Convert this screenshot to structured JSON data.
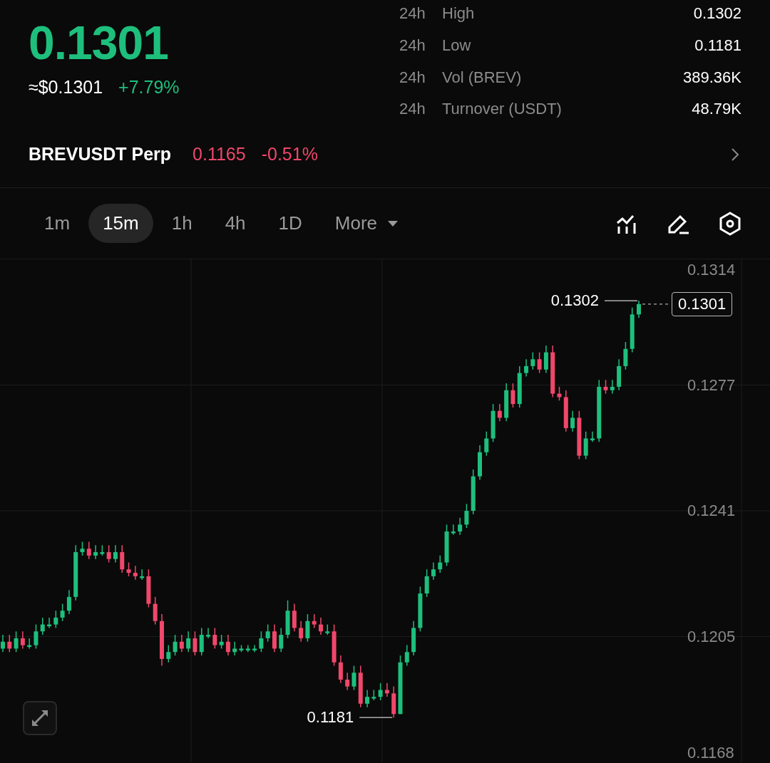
{
  "ticker": {
    "last_price": "0.1301",
    "usd_price": "≈$0.1301",
    "change": "+7.79%"
  },
  "stats": [
    {
      "period": "24h",
      "label": "High",
      "value": "0.1302"
    },
    {
      "period": "24h",
      "label": "Low",
      "value": "0.1181"
    },
    {
      "period": "24h",
      "label": "Vol (BREV)",
      "value": "389.36K"
    },
    {
      "period": "24h",
      "label": "Turnover (USDT)",
      "value": "48.79K"
    }
  ],
  "perp": {
    "name": "BREVUSDT Perp",
    "price": "0.1165",
    "change": "-0.51%"
  },
  "intervals": [
    {
      "label": "1m",
      "selected": false
    },
    {
      "label": "15m",
      "selected": true
    },
    {
      "label": "1h",
      "selected": false
    },
    {
      "label": "4h",
      "selected": false
    },
    {
      "label": "1D",
      "selected": false
    },
    {
      "label": "More",
      "selected": false,
      "kind": "dropdown"
    }
  ],
  "chart": {
    "chart_data": {
      "type": "candlestick",
      "grid": true,
      "ohlc": [
        [
          0.1201,
          0.1205,
          0.12,
          0.1203
        ],
        [
          0.1203,
          0.1205,
          0.12,
          0.1201
        ],
        [
          0.1201,
          0.1206,
          0.12,
          0.1204
        ],
        [
          0.1204,
          0.1206,
          0.1201,
          0.1202
        ],
        [
          0.1202,
          0.1204,
          0.1201,
          0.1202
        ],
        [
          0.1202,
          0.1208,
          0.1201,
          0.1206
        ],
        [
          0.1206,
          0.121,
          0.1205,
          0.1208
        ],
        [
          0.1208,
          0.121,
          0.1207,
          0.1208
        ],
        [
          0.1208,
          0.1212,
          0.1207,
          0.121
        ],
        [
          0.121,
          0.1214,
          0.1209,
          0.1212
        ],
        [
          0.1212,
          0.1218,
          0.1211,
          0.1216
        ],
        [
          0.1216,
          0.1231,
          0.1215,
          0.1229
        ],
        [
          0.1229,
          0.1232,
          0.1228,
          0.123
        ],
        [
          0.123,
          0.1232,
          0.1227,
          0.1228
        ],
        [
          0.1228,
          0.1231,
          0.1227,
          0.1229
        ],
        [
          0.1229,
          0.1231,
          0.1228,
          0.1229
        ],
        [
          0.1229,
          0.1231,
          0.1226,
          0.1227
        ],
        [
          0.1227,
          0.1231,
          0.1226,
          0.1229
        ],
        [
          0.1229,
          0.1231,
          0.1223,
          0.1224
        ],
        [
          0.1224,
          0.1226,
          0.1222,
          0.1223
        ],
        [
          0.1223,
          0.1225,
          0.1221,
          0.1222
        ],
        [
          0.1222,
          0.1224,
          0.1221,
          0.1222
        ],
        [
          0.1222,
          0.1224,
          0.1213,
          0.1214
        ],
        [
          0.1214,
          0.1216,
          0.1208,
          0.1209
        ],
        [
          0.1209,
          0.1211,
          0.1196,
          0.1198
        ],
        [
          0.1198,
          0.1202,
          0.1197,
          0.12
        ],
        [
          0.12,
          0.1205,
          0.1199,
          0.1203
        ],
        [
          0.1203,
          0.1205,
          0.12,
          0.1201
        ],
        [
          0.1201,
          0.1206,
          0.12,
          0.1204
        ],
        [
          0.1204,
          0.1206,
          0.1199,
          0.12
        ],
        [
          0.12,
          0.1207,
          0.1199,
          0.1205
        ],
        [
          0.1205,
          0.1207,
          0.1204,
          0.1205
        ],
        [
          0.1205,
          0.1207,
          0.1201,
          0.1202
        ],
        [
          0.1202,
          0.1205,
          0.1201,
          0.1203
        ],
        [
          0.1203,
          0.1205,
          0.1199,
          0.12
        ],
        [
          0.12,
          0.1203,
          0.1199,
          0.1201
        ],
        [
          0.1201,
          0.1202,
          0.12,
          0.1201
        ],
        [
          0.1201,
          0.1202,
          0.12,
          0.1201
        ],
        [
          0.1201,
          0.1202,
          0.12,
          0.1201
        ],
        [
          0.1201,
          0.1206,
          0.12,
          0.1204
        ],
        [
          0.1204,
          0.1208,
          0.1203,
          0.1206
        ],
        [
          0.1206,
          0.1208,
          0.12,
          0.1201
        ],
        [
          0.1201,
          0.1207,
          0.12,
          0.1205
        ],
        [
          0.1205,
          0.1215,
          0.1204,
          0.1212
        ],
        [
          0.1212,
          0.1214,
          0.1206,
          0.1207
        ],
        [
          0.1207,
          0.1209,
          0.1203,
          0.1204
        ],
        [
          0.1204,
          0.1211,
          0.1203,
          0.1209
        ],
        [
          0.1209,
          0.1211,
          0.1207,
          0.1208
        ],
        [
          0.1208,
          0.121,
          0.1205,
          0.1206
        ],
        [
          0.1206,
          0.1208,
          0.1205,
          0.1206
        ],
        [
          0.1206,
          0.1208,
          0.1196,
          0.1197
        ],
        [
          0.1197,
          0.1199,
          0.1191,
          0.1192
        ],
        [
          0.1192,
          0.1194,
          0.1189,
          0.119
        ],
        [
          0.119,
          0.1196,
          0.1189,
          0.1194
        ],
        [
          0.1194,
          0.1196,
          0.1184,
          0.1185
        ],
        [
          0.1185,
          0.1189,
          0.1184,
          0.1187
        ],
        [
          0.1187,
          0.1189,
          0.1186,
          0.1187
        ],
        [
          0.1187,
          0.1191,
          0.1186,
          0.1189
        ],
        [
          0.1189,
          0.1191,
          0.1187,
          0.1188
        ],
        [
          0.1188,
          0.119,
          0.1181,
          0.1182
        ],
        [
          0.1182,
          0.1199,
          0.1182,
          0.1197
        ],
        [
          0.1197,
          0.1202,
          0.1196,
          0.12
        ],
        [
          0.12,
          0.1209,
          0.1199,
          0.1207
        ],
        [
          0.1207,
          0.1219,
          0.1206,
          0.1217
        ],
        [
          0.1217,
          0.1224,
          0.1216,
          0.1222
        ],
        [
          0.1222,
          0.1226,
          0.1221,
          0.1224
        ],
        [
          0.1224,
          0.1228,
          0.1223,
          0.1226
        ],
        [
          0.1226,
          0.1237,
          0.1225,
          0.1235
        ],
        [
          0.1235,
          0.1237,
          0.1234,
          0.1235
        ],
        [
          0.1235,
          0.1239,
          0.1234,
          0.1237
        ],
        [
          0.1237,
          0.1243,
          0.1236,
          0.1241
        ],
        [
          0.1241,
          0.1253,
          0.124,
          0.1251
        ],
        [
          0.1251,
          0.126,
          0.125,
          0.1258
        ],
        [
          0.1258,
          0.1264,
          0.1257,
          0.1262
        ],
        [
          0.1262,
          0.1272,
          0.1261,
          0.127
        ],
        [
          0.127,
          0.1272,
          0.1267,
          0.1268
        ],
        [
          0.1268,
          0.1278,
          0.1267,
          0.1276
        ],
        [
          0.1276,
          0.1278,
          0.1271,
          0.1272
        ],
        [
          0.1272,
          0.1283,
          0.1271,
          0.1281
        ],
        [
          0.1281,
          0.1285,
          0.128,
          0.1283
        ],
        [
          0.1283,
          0.1287,
          0.1282,
          0.1285
        ],
        [
          0.1285,
          0.1287,
          0.1281,
          0.1282
        ],
        [
          0.1282,
          0.1289,
          0.1281,
          0.1287
        ],
        [
          0.1287,
          0.1289,
          0.1274,
          0.1275
        ],
        [
          0.1275,
          0.1277,
          0.1273,
          0.1274
        ],
        [
          0.1274,
          0.1276,
          0.1264,
          0.1265
        ],
        [
          0.1265,
          0.127,
          0.1264,
          0.1268
        ],
        [
          0.1268,
          0.127,
          0.1256,
          0.1257
        ],
        [
          0.1257,
          0.1264,
          0.1256,
          0.1262
        ],
        [
          0.1262,
          0.1264,
          0.1261,
          0.1262
        ],
        [
          0.1262,
          0.1279,
          0.1261,
          0.1277
        ],
        [
          0.1277,
          0.1279,
          0.1275,
          0.1276
        ],
        [
          0.1276,
          0.1279,
          0.1275,
          0.1277
        ],
        [
          0.1277,
          0.1285,
          0.1276,
          0.1283
        ],
        [
          0.1283,
          0.129,
          0.1282,
          0.1288
        ],
        [
          0.1288,
          0.13,
          0.1287,
          0.1298
        ],
        [
          0.1298,
          0.1302,
          0.1297,
          0.1301
        ]
      ],
      "ylim": [
        0.1168,
        0.1314
      ],
      "yticks": [
        {
          "value": 0.1314,
          "label": "0.1314"
        },
        {
          "value": 0.12775,
          "label": "0.1277"
        },
        {
          "value": 0.1241,
          "label": "0.1241"
        },
        {
          "value": 0.12045,
          "label": "0.1205"
        },
        {
          "value": 0.1168,
          "label": "0.1168"
        }
      ]
    },
    "markers": [
      {
        "kind": "high",
        "text": "0.1302"
      },
      {
        "kind": "low",
        "text": "0.1181"
      },
      {
        "kind": "last",
        "text": "0.1301"
      }
    ]
  }
}
